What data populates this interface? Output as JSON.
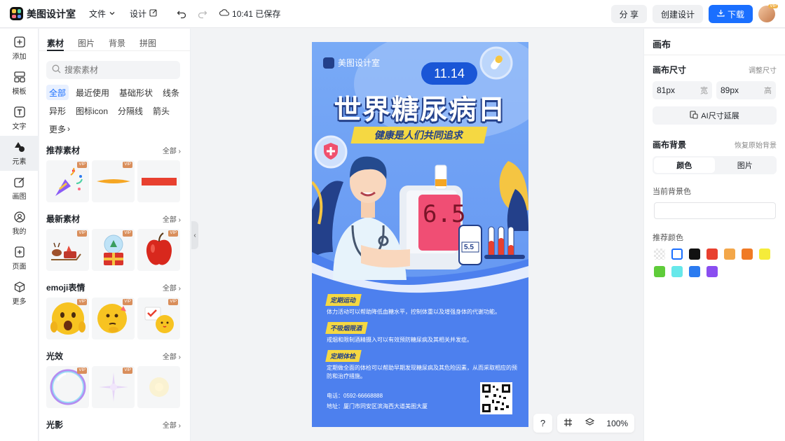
{
  "app": {
    "name": "美图设计室"
  },
  "topbar": {
    "file_label": "文件",
    "design_label": "设计",
    "save_status": "10:41 已保存",
    "share_label": "分 享",
    "create_label": "创建设计",
    "download_label": "下载",
    "avatar_badge": "VIP"
  },
  "rail": {
    "items": [
      {
        "label": "添加",
        "icon": "plus-square-icon"
      },
      {
        "label": "模板",
        "icon": "template-icon"
      },
      {
        "label": "文字",
        "icon": "text-icon"
      },
      {
        "label": "元素",
        "icon": "shapes-icon"
      },
      {
        "label": "画图",
        "icon": "edit-icon"
      },
      {
        "label": "我的",
        "icon": "user-icon"
      },
      {
        "label": "页面",
        "icon": "add-page-icon"
      },
      {
        "label": "更多",
        "icon": "cube-icon"
      }
    ]
  },
  "panel": {
    "tabs": [
      "素材",
      "图片",
      "背景",
      "拼图"
    ],
    "search_placeholder": "搜索素材",
    "chips": [
      "全部",
      "最近使用",
      "基础形状",
      "线条",
      "异形",
      "图标icon",
      "分隔线",
      "箭头",
      "更多"
    ],
    "vip_label": "VIP",
    "sections": [
      {
        "title": "推荐素材",
        "all": "全部"
      },
      {
        "title": "最新素材",
        "all": "全部"
      },
      {
        "title": "emoji表情",
        "all": "全部"
      },
      {
        "title": "光效",
        "all": "全部"
      },
      {
        "title": "光影",
        "all": "全部"
      }
    ]
  },
  "poster": {
    "brand": "美图设计室",
    "date": "11.14",
    "title": "世界糖尿病日",
    "subtitle": "健康是人们共同追求",
    "meter_reading": "6.5",
    "meter_small": "5.5",
    "items": [
      {
        "head": "定期运动",
        "text": "体力活动可以帮助降低血糖水平，控制体重以及增强身体的代谢功能。"
      },
      {
        "head": "不吸烟限酒",
        "text": "戒烟和限制酒精摄入可以有效预防糖尿病及其相关并发症。"
      },
      {
        "head": "定期体检",
        "text": "定期做全面的体检可以帮助早期发现糖尿病及其危险因素，从而采取相应的预防和治疗措施。"
      }
    ],
    "phone": "电话：0592-66668888",
    "address": "地址：厦门市同安区滨海西大道美图大厦"
  },
  "canvas_tools": {
    "help": "?",
    "zoom": "100%"
  },
  "right": {
    "title": "画布",
    "size_label": "画布尺寸",
    "adjust_label": "调整尺寸",
    "width_value": "81px",
    "width_unit": "宽",
    "height_value": "89px",
    "height_unit": "高",
    "ai_label": "AI尺寸延展",
    "bg_label": "画布背景",
    "restore_label": "恢复原始背景",
    "seg_color": "颜色",
    "seg_image": "图片",
    "current_bg_label": "当前背景色",
    "recommend_label": "推荐颜色",
    "swatches": [
      "transparent",
      "#ffffff",
      "#111111",
      "#e8402f",
      "#f3a74a",
      "#f07a25",
      "#f5ec3a",
      "#5fcc3a",
      "#67e8ea",
      "#2b7bf0",
      "#8a4ef0"
    ]
  }
}
